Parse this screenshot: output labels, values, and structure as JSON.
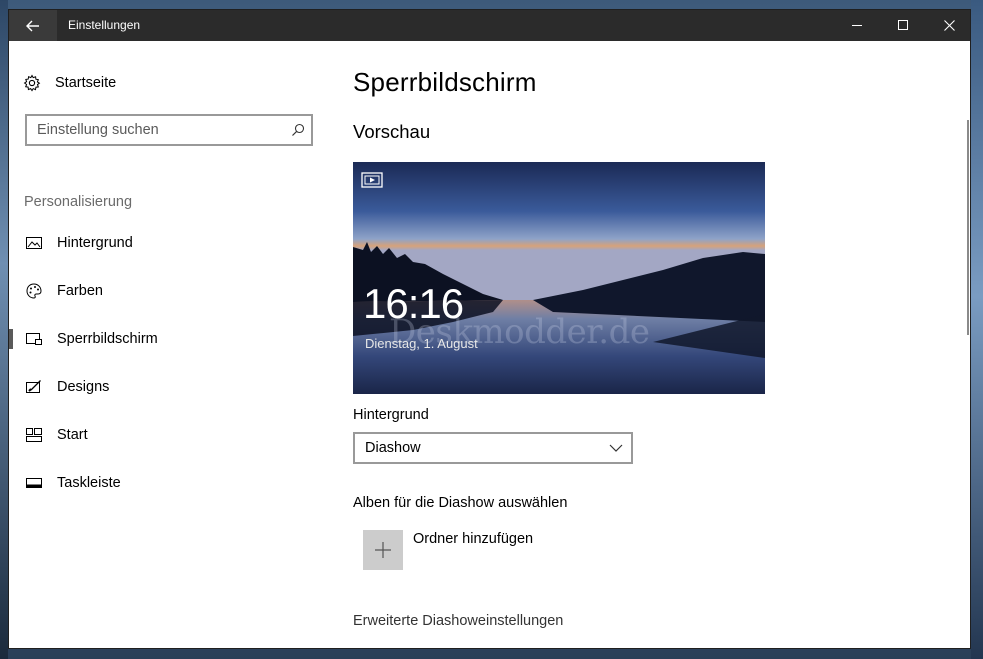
{
  "window": {
    "title": "Einstellungen"
  },
  "sidebar": {
    "home_label": "Startseite",
    "search_placeholder": "Einstellung suchen",
    "section_header": "Personalisierung",
    "items": [
      {
        "label": "Hintergrund",
        "icon": "image-icon"
      },
      {
        "label": "Farben",
        "icon": "palette-icon"
      },
      {
        "label": "Sperrbildschirm",
        "icon": "lock-screen-icon",
        "active": true
      },
      {
        "label": "Designs",
        "icon": "brush-icon"
      },
      {
        "label": "Start",
        "icon": "start-grid-icon"
      },
      {
        "label": "Taskleiste",
        "icon": "taskbar-icon"
      }
    ]
  },
  "main": {
    "title": "Sperrbildschirm",
    "preview_heading": "Vorschau",
    "preview": {
      "time": "16:16",
      "date": "Dienstag, 1. August",
      "watermark": "Deskmodder.de"
    },
    "background_label": "Hintergrund",
    "background_value": "Diashow",
    "albums_label": "Alben für die Diashow auswählen",
    "add_folder_label": "Ordner hinzufügen",
    "advanced_link": "Erweiterte Diashoweinstellungen"
  },
  "colors": {
    "titlebar": "#2b2b2b",
    "accent_border": "#999999",
    "section_header": "#6b6b6b"
  }
}
